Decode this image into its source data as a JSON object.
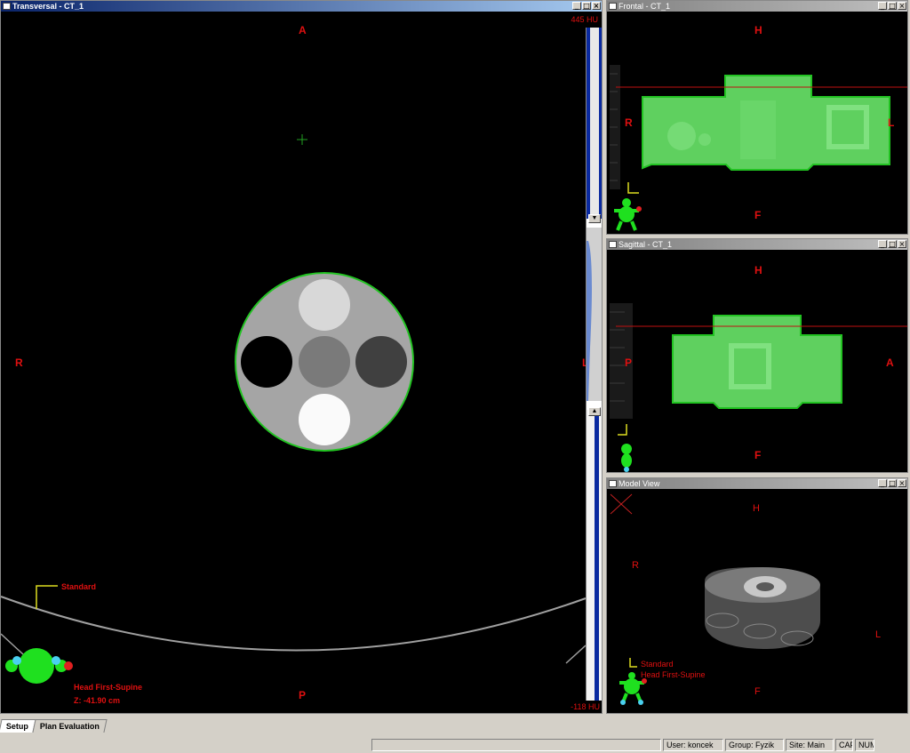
{
  "transversal": {
    "title": "Transversal - CT_1",
    "orient": {
      "top": "A",
      "left": "R",
      "bottom": "P",
      "right": "L"
    },
    "hu_top": "445 HU",
    "hu_bottom": "-118 HU",
    "standard_label": "Standard",
    "patient_position": "Head First-Supine",
    "z_position": "Z: -41.90 cm"
  },
  "frontal": {
    "title": "Frontal - CT_1",
    "orient": {
      "top": "H",
      "left": "R",
      "bottom": "F",
      "right": "L"
    }
  },
  "sagittal": {
    "title": "Sagittal - CT_1",
    "orient": {
      "top": "H",
      "left": "P",
      "bottom": "F",
      "right": "A"
    }
  },
  "model": {
    "title": "Model View",
    "orient": {
      "top": "H",
      "left": "R",
      "bottom": "F",
      "right": "L"
    },
    "standard_label": "Standard",
    "patient_position": "Head First-Supine"
  },
  "window_buttons": {
    "minimize": "_",
    "maximize": "□",
    "close": "×"
  },
  "tabs": [
    "Setup",
    "Plan Evaluation"
  ],
  "status": {
    "user": "User: koncek",
    "group": "Group: Fyzik",
    "site": "Site: Main",
    "cap": "CAP",
    "num": "NUM"
  },
  "colors": {
    "contour": "#22c322",
    "body_fill": "#5fd05f",
    "orientation_text": "#e01010",
    "active_title": "#0a246a"
  }
}
